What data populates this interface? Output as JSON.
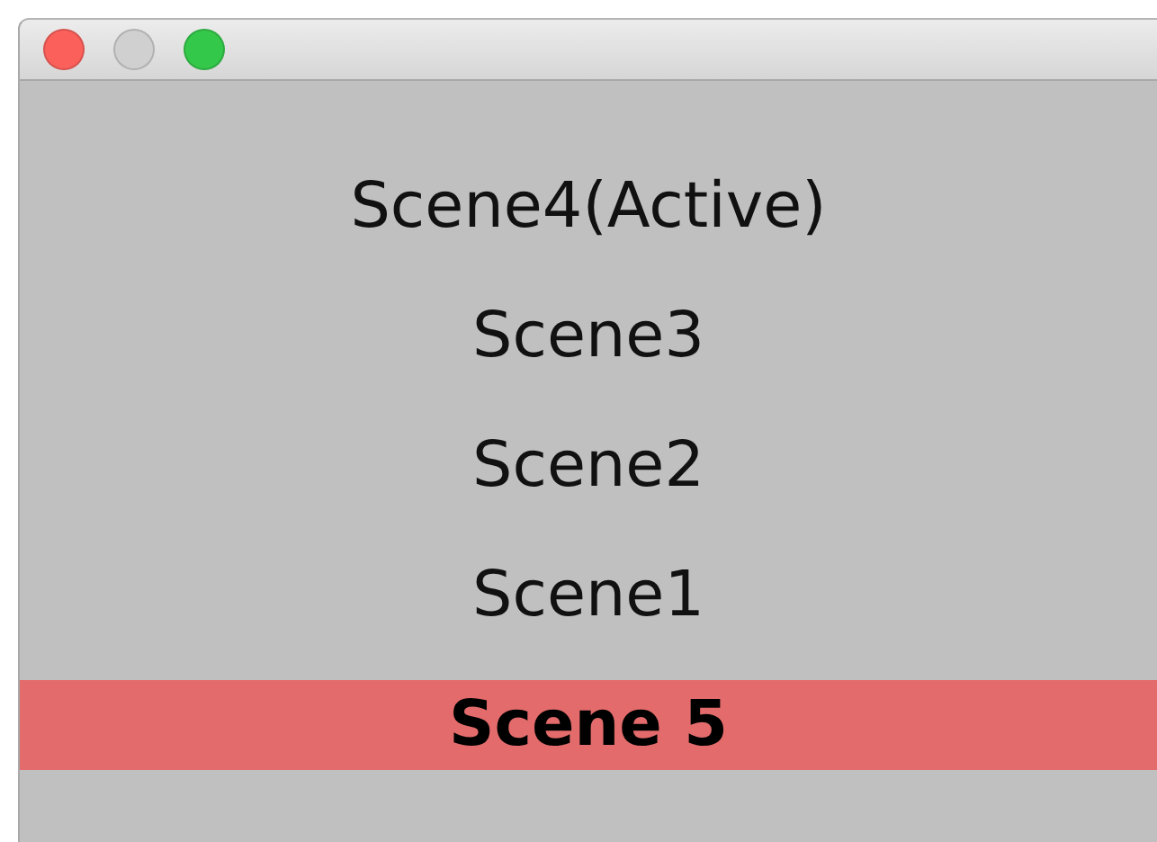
{
  "window_buttons": [
    {
      "kind": "close",
      "disabled": false
    },
    {
      "kind": "minimize",
      "disabled": true
    },
    {
      "kind": "zoom",
      "disabled": false
    }
  ],
  "scenes": [
    {
      "label": "Scene4(Active)",
      "selected": false
    },
    {
      "label": "Scene3",
      "selected": false
    },
    {
      "label": "Scene2",
      "selected": false
    },
    {
      "label": "Scene1",
      "selected": false
    },
    {
      "label": "Scene 5",
      "selected": true
    }
  ]
}
